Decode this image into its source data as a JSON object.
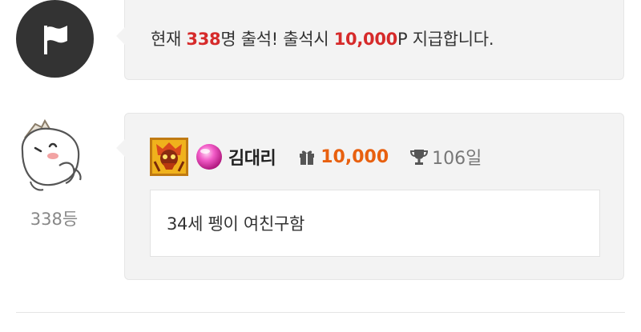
{
  "notice": {
    "icon": "flag-icon",
    "text_1": "현재 ",
    "count": "338",
    "text_2": "명 출석! 출석시 ",
    "reward": "10,000",
    "text_3": "P 지급합니다.",
    "highlight_color": "#d62a2a"
  },
  "entry": {
    "avatar_icon": "cartoon-avatar",
    "rank": "338등",
    "level_icon": "level-badge-icon",
    "orb_icon": "pink-orb-icon",
    "username": "김대리",
    "gift_icon": "gift-icon",
    "points": "10,000",
    "points_color": "#e8600f",
    "trophy_icon": "trophy-icon",
    "days": "106일",
    "comment": "34세 펭이 여친구함"
  }
}
